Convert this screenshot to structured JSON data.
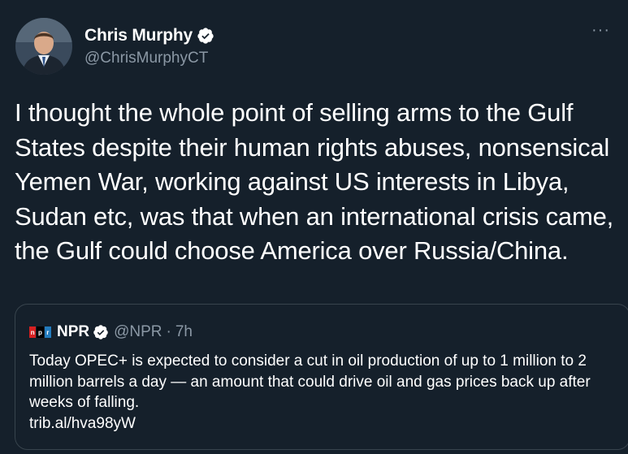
{
  "author": {
    "display_name": "Chris Murphy",
    "handle": "@ChrisMurphyCT",
    "verified": true
  },
  "more_label": "···",
  "tweet": {
    "text": "I thought the whole point of selling arms to the Gulf States despite their human rights abuses, nonsensical Yemen War, working against US interests in Libya, Sudan etc, was that when an international crisis came, the Gulf could choose America over Russia/China."
  },
  "quoted_tweet": {
    "logo_letters": [
      "n",
      "p",
      "r"
    ],
    "display_name": "NPR",
    "verified": true,
    "handle": "@NPR",
    "separator": "·",
    "time": "7h",
    "text": "Today OPEC+ is expected to consider a cut in oil production of up to 1 million to 2 million barrels a day — an amount that could drive oil and gas prices back up after weeks of falling.",
    "link": "trib.al/hva98yW"
  },
  "colors": {
    "background": "#15202b",
    "text_primary": "#ffffff",
    "text_secondary": "#8b98a5",
    "border": "#38444d",
    "logo_red": "#d62021",
    "logo_black": "#000000",
    "logo_blue": "#237bbd"
  }
}
